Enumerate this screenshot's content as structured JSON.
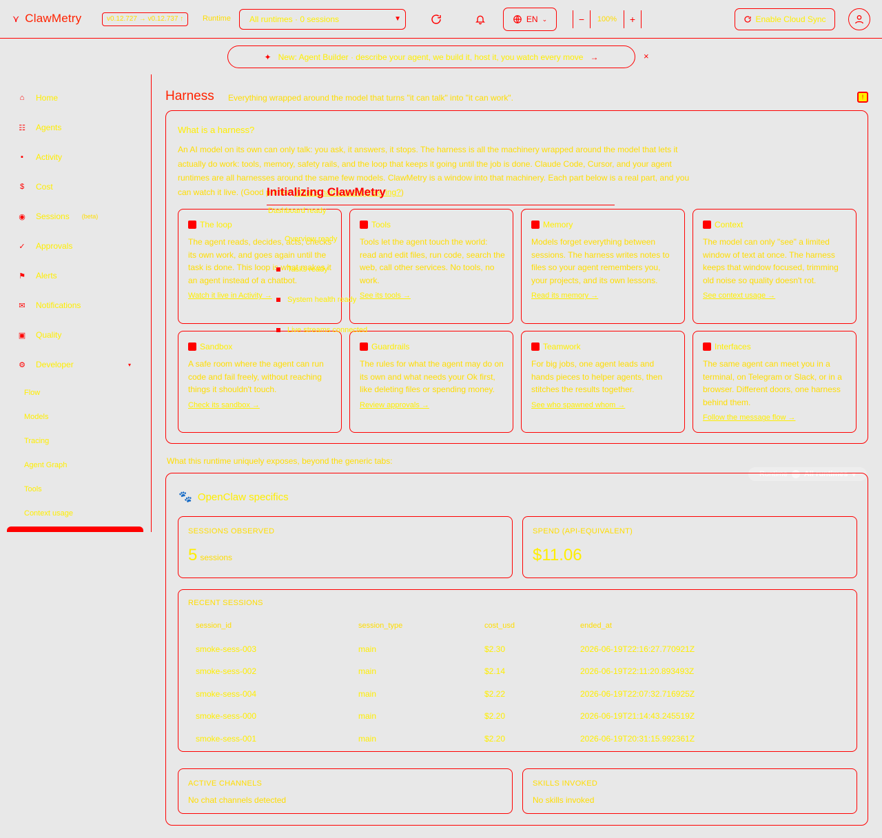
{
  "app": {
    "name": "ClawMetry",
    "version": "v0.12.727 → v0.12.737 ↑",
    "runtime_label": "Runtime",
    "runtime_value": "All runtimes · 0 sessions",
    "lang": "EN",
    "zoom": "100%",
    "zoom_out": "−",
    "zoom_in": "+",
    "cloud_sync": "Enable Cloud Sync"
  },
  "banner": {
    "text": "New: Agent Builder · describe your agent, we build it, host it, you watch every move",
    "arrow": "→",
    "close": "×"
  },
  "sidebar": {
    "items": [
      {
        "label": "Home",
        "icon": "home-icon",
        "glyph": "⌂"
      },
      {
        "label": "Agents",
        "icon": "agents-icon",
        "glyph": "☷"
      },
      {
        "label": "Activity",
        "icon": "activity-icon",
        "glyph": "▪"
      },
      {
        "label": "Cost",
        "icon": "dollar-icon",
        "glyph": "$"
      },
      {
        "label": "Sessions",
        "icon": "sessions-icon",
        "glyph": "◉",
        "badge": "(beta)"
      },
      {
        "label": "Approvals",
        "icon": "check-icon",
        "glyph": "✓"
      },
      {
        "label": "Alerts",
        "icon": "flag-icon",
        "glyph": "⚑"
      },
      {
        "label": "Notifications",
        "icon": "mail-icon",
        "glyph": "✉"
      },
      {
        "label": "Quality",
        "icon": "clipboard-icon",
        "glyph": "▣"
      },
      {
        "label": "Developer",
        "icon": "gear-icon",
        "glyph": "⚙",
        "caret": "▾"
      }
    ],
    "sub_items": [
      "Flow",
      "Models",
      "Tracing",
      "Agent Graph",
      "Tools",
      "Context usage"
    ]
  },
  "page": {
    "title": "Harness",
    "subtitle": "Everything wrapped around the model that turns \"it can talk\" into \"it can work\".",
    "what_title": "What is a harness?",
    "what_body": "An AI model on its own can only talk: you ask, it answers, it stops. The harness is all the machinery wrapped around the model that lets it actually do work: tools, memory, safety rails, and the loop that keeps it going until the job is done. Claude Code, Cursor, and your agent runtimes are all harnesses around the same few models. ClawMetry is a window into that machinery. Each part below is a real part, and you can watch it live. (Good primer:",
    "what_link": "What's harness engineering?",
    "what_end": ")",
    "section_note": "What this runtime uniquely exposes, beyond the generic tabs:",
    "runtime_pill_label": "Runtime",
    "runtime_pill_value": "All runtimes"
  },
  "cards": [
    {
      "title": "The loop",
      "icon": "loop-icon",
      "body": "The agent reads, decides, acts, checks its own work, and goes again until the task is done. This loop is what makes it an agent instead of a chatbot.",
      "link": "Watch it live in Activity →"
    },
    {
      "title": "Tools",
      "icon": "wrench-icon",
      "body": "Tools let the agent touch the world: read and edit files, run code, search the web, call other services. No tools, no work.",
      "link": "See its tools →"
    },
    {
      "title": "Memory",
      "icon": "memory-icon",
      "body": "Models forget everything between sessions. The harness writes notes to files so your agent remembers you, your projects, and its own lessons.",
      "link": "Read its memory →"
    },
    {
      "title": "Context",
      "icon": "context-icon",
      "body": "The model can only \"see\" a limited window of text at once. The harness keeps that window focused, trimming old noise so quality doesn't rot.",
      "link": "See context usage →"
    },
    {
      "title": "Sandbox",
      "icon": "sandbox-icon",
      "body": "A safe room where the agent can run code and fail freely, without reaching things it shouldn't touch.",
      "link": "Check its sandbox →"
    },
    {
      "title": "Guardrails",
      "icon": "shield-icon",
      "body": "The rules for what the agent may do on its own and what needs your Ok first, like deleting files or spending money.",
      "link": "Review approvals →"
    },
    {
      "title": "Teamwork",
      "icon": "team-icon",
      "body": "For big jobs, one agent leads and hands pieces to helper agents, then stitches the results together.",
      "link": "See who spawned whom →"
    },
    {
      "title": "Interfaces",
      "icon": "chat-icon",
      "body": "The same agent can meet you in a terminal, on Telegram or Slack, or in a browser. Different doors, one harness behind them.",
      "link": "Follow the message flow →"
    }
  ],
  "openclaw": {
    "title": "OpenClaw specifics",
    "sessions_label": "SESSIONS OBSERVED",
    "sessions_value": "5",
    "sessions_unit": "sessions",
    "spend_label": "SPEND (API-EQUIVALENT)",
    "spend_value": "$11.06",
    "recent_label": "RECENT SESSIONS",
    "columns": [
      "session_id",
      "session_type",
      "cost_usd",
      "ended_at"
    ],
    "rows": [
      [
        "smoke-sess-003",
        "main",
        "$2.30",
        "2026-06-19T22:16:27.770921Z"
      ],
      [
        "smoke-sess-002",
        "main",
        "$2.14",
        "2026-06-19T22:11:20.893493Z"
      ],
      [
        "smoke-sess-004",
        "main",
        "$2.22",
        "2026-06-19T22:07:32.716925Z"
      ],
      [
        "smoke-sess-000",
        "main",
        "$2.20",
        "2026-06-19T21:14:43.245519Z"
      ],
      [
        "smoke-sess-001",
        "main",
        "$2.20",
        "2026-06-19T20:31:15.992361Z"
      ]
    ],
    "channels_label": "ACTIVE CHANNELS",
    "channels_value": "No chat channels detected",
    "skills_label": "SKILLS INVOKED",
    "skills_value": "No skills invoked"
  },
  "overlay": {
    "title": "Initializing ClawMetry",
    "steps": [
      "Dashboard ready",
      "Overview ready",
      "Tasks ready",
      "System health ready",
      "Live streams connected"
    ]
  },
  "colors": {
    "accent": "#ff0000",
    "text": "#ffee00",
    "bg": "#e8e8e8"
  }
}
